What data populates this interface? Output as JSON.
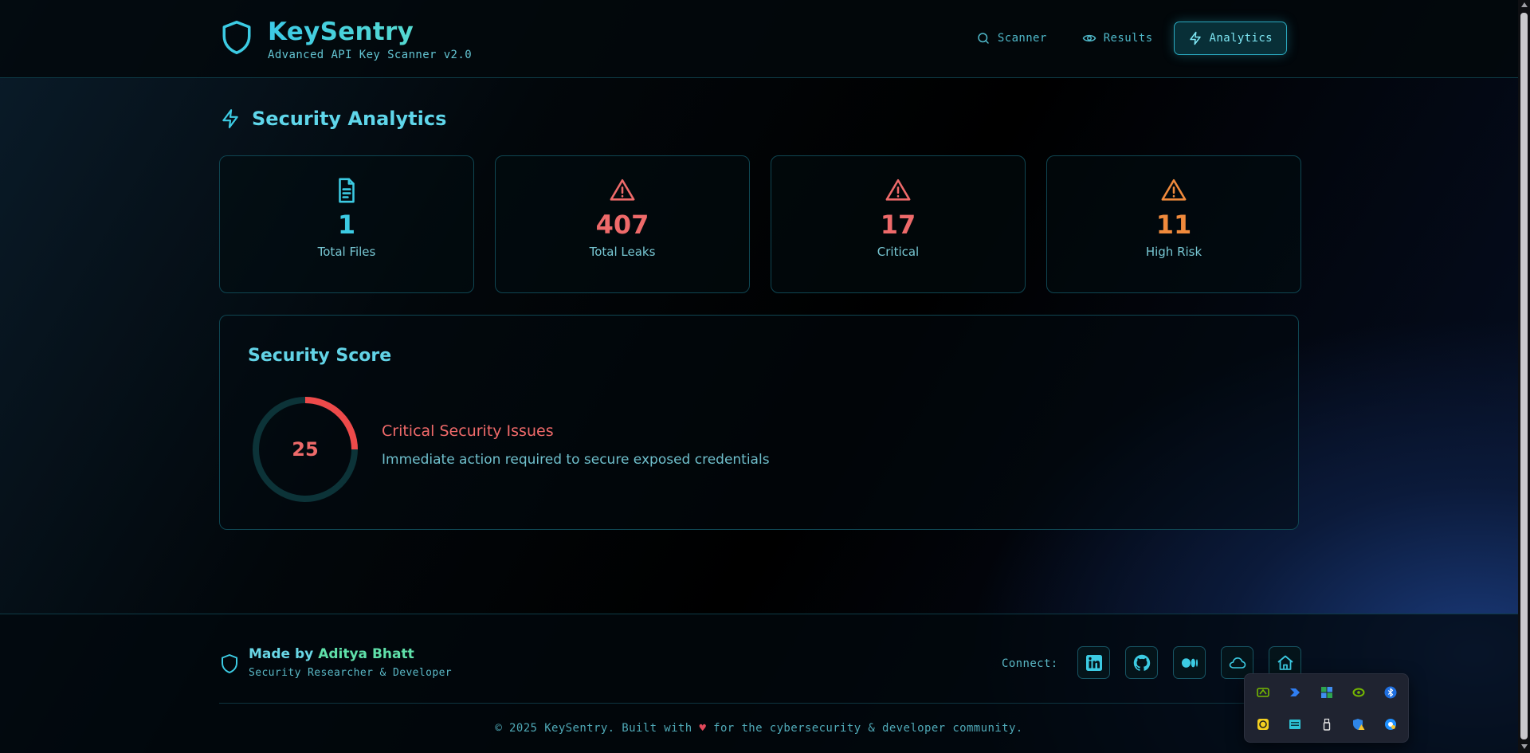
{
  "app": {
    "title": "KeySentry",
    "subtitle": "Advanced API Key Scanner v2.0"
  },
  "nav": {
    "scanner": "Scanner",
    "results": "Results",
    "analytics": "Analytics",
    "active": "Analytics"
  },
  "section": {
    "title": "Security Analytics"
  },
  "stats": [
    {
      "value": "1",
      "label": "Total Files",
      "icon": "file-text-icon",
      "color": "#3ccbe3"
    },
    {
      "value": "407",
      "label": "Total Leaks",
      "icon": "warning-triangle-icon",
      "color": "#ee6a6a"
    },
    {
      "value": "17",
      "label": "Critical",
      "icon": "warning-triangle-icon",
      "color": "#ee6a6a"
    },
    {
      "value": "11",
      "label": "High Risk",
      "icon": "warning-triangle-icon",
      "color": "#f08a3c"
    }
  ],
  "score": {
    "title": "Security Score",
    "value": 25,
    "max": 100,
    "status": "Critical Security Issues",
    "description": "Immediate action required to secure exposed credentials",
    "color": "#ee4a4a",
    "track_color": "#0c3338"
  },
  "footer": {
    "made_by_prefix": "Made by",
    "author": "Aditya Bhatt",
    "role": "Security Researcher & Developer",
    "connect_label": "Connect:",
    "socials": [
      "linkedin-icon",
      "github-icon",
      "medium-icon",
      "cloud-icon",
      "home-icon"
    ],
    "copyright_prefix": "© 2025 KeySentry. Built with",
    "copyright_suffix": "for the cybersecurity & developer community."
  },
  "tray": {
    "icons": [
      "nvidia-broadcast-icon",
      "power-automate-icon",
      "app-grid-icon",
      "nvidia-icon",
      "bluetooth-icon",
      "yellow-app-icon",
      "display-app-icon",
      "usb-drive-icon",
      "security-warning-icon",
      "network-app-icon"
    ]
  },
  "colors": {
    "accent": "#3ccbe3",
    "critical": "#ee6a6a",
    "high": "#f08a3c",
    "author": "#5fe0a9"
  }
}
